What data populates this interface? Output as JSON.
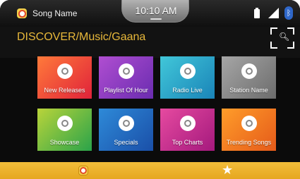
{
  "status_bar": {
    "song_name": "Song Name",
    "time": "10:10 AM",
    "icons": [
      "gaana-app-icon",
      "battery-icon",
      "signal-icon",
      "bluetooth-icon"
    ]
  },
  "header": {
    "breadcrumb": "DISCOVER/Music/Gaana",
    "search_icon": "search-icon"
  },
  "tiles": [
    {
      "label": "New Releases"
    },
    {
      "label": "Playlist Of Hour"
    },
    {
      "label": "Radio Live"
    },
    {
      "label": "Station Name"
    },
    {
      "label": "Showcase"
    },
    {
      "label": "Specials"
    },
    {
      "label": "Top Charts"
    },
    {
      "label": "Trending Songs"
    }
  ],
  "bottom_nav": {
    "items": [
      "gaana-icon",
      "star-icon"
    ],
    "accent": "#f0b52d"
  }
}
